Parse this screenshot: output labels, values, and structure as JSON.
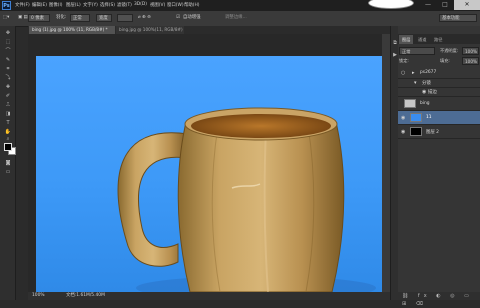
{
  "menubar": {
    "logo": "Ps",
    "items": [
      "文件(F)",
      "编辑(E)",
      "图像(I)",
      "图层(L)",
      "文字(Y)",
      "选择(S)",
      "滤镜(T)",
      "3D(D)",
      "视图(V)",
      "窗口(W)",
      "帮助(H)"
    ],
    "minimize": "—",
    "maximize": "□",
    "close": "✕"
  },
  "options": {
    "feather_label": "羽化:",
    "feather_value": "0 像素",
    "mode_value": "正常",
    "width_value": "宽度",
    "auto_enhance": "自动增强",
    "refine_edge": "调整边缘...",
    "workspace": "基本功能"
  },
  "tabs": [
    {
      "label": "bing (1).jpg @ 100% (11, RGB/8#) *"
    },
    {
      "label": "bing.jpg @ 100%(11, RGB/8#)"
    }
  ],
  "status": {
    "zoom": "100%",
    "doc_info": "文档:1.61M/5.40M"
  },
  "layers_panel": {
    "tabs": [
      "图层",
      "通道",
      "路径"
    ],
    "blend_mode": "正常",
    "opacity_label": "不透明度:",
    "opacity_value": "100%",
    "lock_label": "锁定:",
    "fill_label": "填充:",
    "fill_value": "100%",
    "layers": [
      {
        "name": "ps2677",
        "thumb_color": "#6a6a6a"
      },
      {
        "name": "分镜",
        "thumb_color": "#6a6a6a"
      },
      {
        "name": "描边",
        "thumb_color": "#6a6a6a"
      },
      {
        "name": "bing",
        "thumb_color": "#c7c7c7"
      },
      {
        "name": "11",
        "thumb_color": "#3a8df0"
      },
      {
        "name": "图层 2",
        "thumb_color": "#000000"
      }
    ],
    "selected_index": 4
  },
  "colors": {
    "canvas_blue": "#3d99f7",
    "selected_layer": "#4d6c94"
  }
}
